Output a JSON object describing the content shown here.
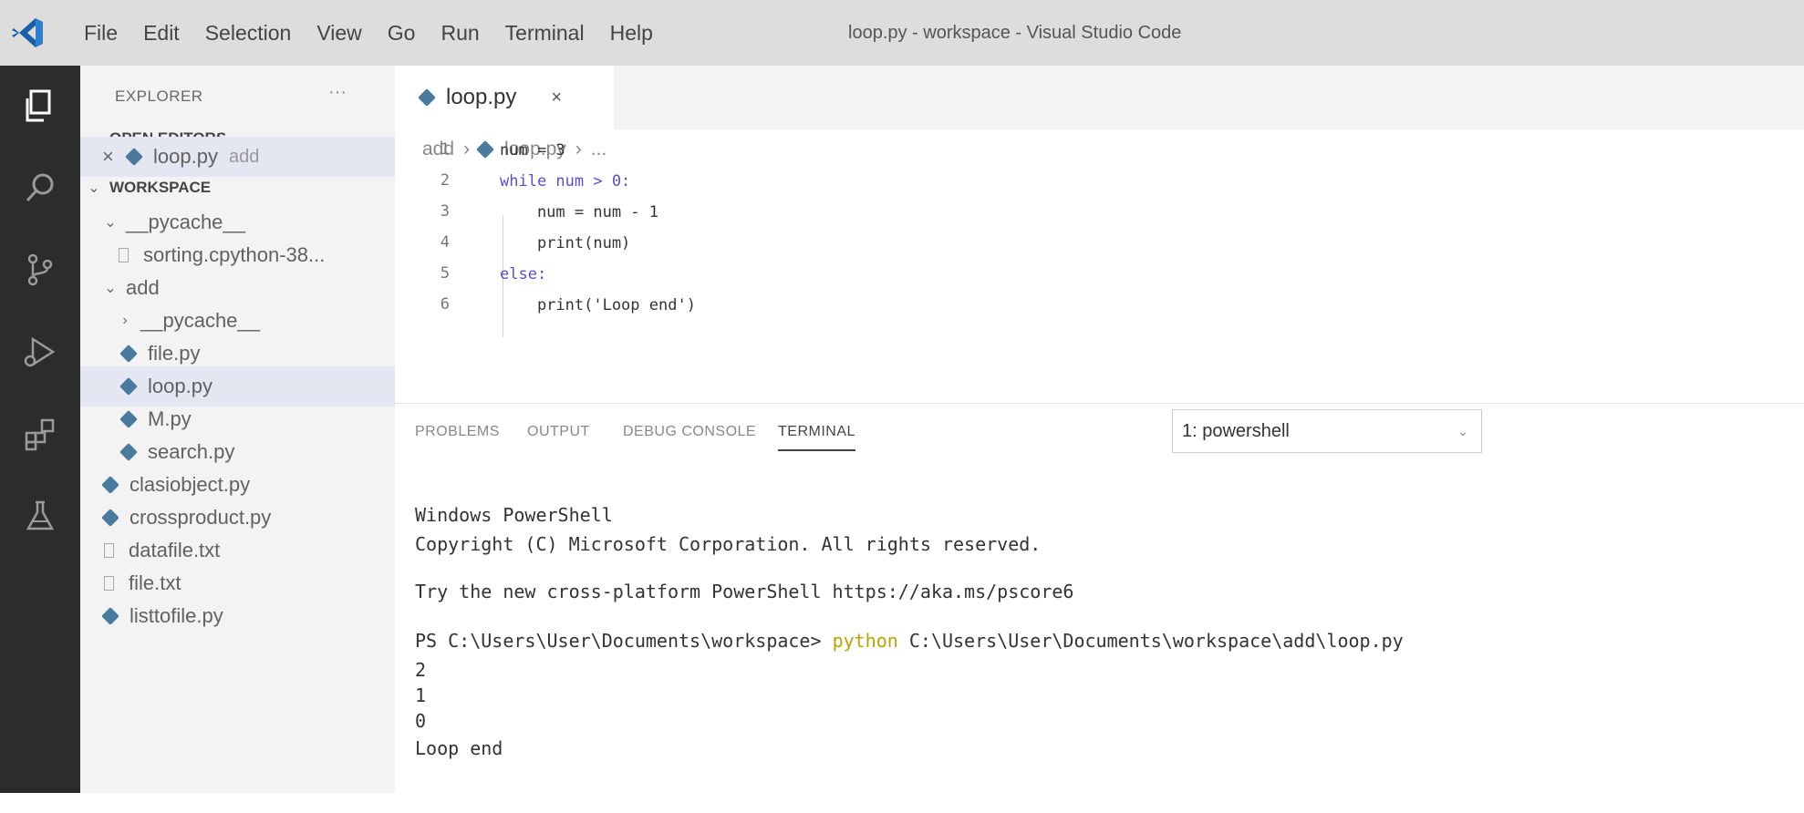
{
  "window": {
    "title": "loop.py - workspace - Visual Studio Code"
  },
  "menu": [
    "File",
    "Edit",
    "Selection",
    "View",
    "Go",
    "Run",
    "Terminal",
    "Help"
  ],
  "sidebar": {
    "title": "EXPLORER",
    "more": "···",
    "open_editors_label": "OPEN EDITORS",
    "open_editor": {
      "close": "×",
      "name": "loop.py",
      "dir": "add"
    },
    "workspace_label": "WORKSPACE",
    "tree": [
      {
        "name": "__pycache__",
        "kind": "folder",
        "expanded": true
      },
      {
        "name": "sorting.cpython-38...",
        "kind": "file"
      },
      {
        "name": "add",
        "kind": "folder",
        "expanded": true
      },
      {
        "name": "__pycache__",
        "kind": "folder",
        "expanded": false
      },
      {
        "name": "file.py",
        "kind": "py"
      },
      {
        "name": "loop.py",
        "kind": "py",
        "selected": true
      },
      {
        "name": "M.py",
        "kind": "py"
      },
      {
        "name": "search.py",
        "kind": "py"
      },
      {
        "name": "clasiobject.py",
        "kind": "py"
      },
      {
        "name": "crossproduct.py",
        "kind": "py"
      },
      {
        "name": "datafile.txt",
        "kind": "txt"
      },
      {
        "name": "file.txt",
        "kind": "txt"
      },
      {
        "name": "listtofile.py",
        "kind": "py"
      }
    ]
  },
  "editor": {
    "tab": {
      "name": "loop.py",
      "close": "×"
    },
    "breadcrumb": [
      "add",
      "loop.py",
      "..."
    ],
    "lines": [
      {
        "n": "1",
        "text": "num = 3"
      },
      {
        "n": "2",
        "text": "while num > 0:"
      },
      {
        "n": "3",
        "text": "    num = num - 1"
      },
      {
        "n": "4",
        "text": "    print(num)"
      },
      {
        "n": "5",
        "text": "else:"
      },
      {
        "n": "6",
        "text": "    print('Loop end')"
      }
    ]
  },
  "panel": {
    "tabs": [
      "PROBLEMS",
      "OUTPUT",
      "DEBUG CONSOLE",
      "TERMINAL"
    ],
    "active_tab": "TERMINAL",
    "terminal_select": "1: powershell",
    "terminal": {
      "line1": "Windows PowerShell",
      "line2": "Copyright (C) Microsoft Corporation. All rights reserved.",
      "line3": "Try the new cross-platform PowerShell https://aka.ms/pscore6",
      "prompt": "PS C:\\Users\\User\\Documents\\workspace> ",
      "command": "python",
      "args": " C:\\Users\\User\\Documents\\workspace\\add\\loop.py",
      "out1": "2",
      "out2": "1",
      "out3": "0",
      "out4": "Loop end"
    }
  },
  "colors": {
    "activity_bar": "#2c2c2c",
    "title_bar": "#dddddd",
    "sidebar": "#f3f3f3",
    "selected_row": "#e4e6f1",
    "py_icon": "#4a7a9e"
  }
}
